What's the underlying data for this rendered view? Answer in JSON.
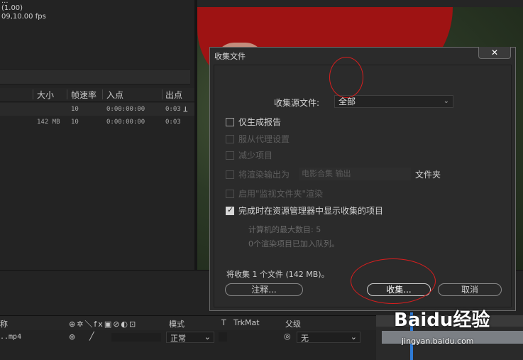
{
  "project_panel": {
    "info_line1": "...",
    "info_line2": "(1.00)",
    "info_line3": "09,10.00 fps",
    "columns": [
      "大小",
      "帧速率",
      "入点",
      "出点"
    ],
    "rows": [
      {
        "size": "",
        "fps": "10",
        "in": "0:00:00:00",
        "out": "0:03"
      },
      {
        "size": "142 MB",
        "fps": "10",
        "in": "0:00:00:00",
        "out": "0:03"
      }
    ]
  },
  "timeline": {
    "columns": {
      "name_suffix": "称",
      "mode": "模式",
      "t": "T",
      "trkmat": "TrkMat",
      "parent": "父级"
    },
    "layer": {
      "name": "..mp4",
      "mode": "正常",
      "parent": "无"
    }
  },
  "dialog": {
    "title": "收集文件",
    "close": "✕",
    "source_label": "收集源文件:",
    "source_value": "全部",
    "options": [
      {
        "label": "仅生成报告",
        "checked": false,
        "enabled": true
      },
      {
        "label": "服从代理设置",
        "checked": false,
        "enabled": false
      },
      {
        "label": "减少项目",
        "checked": false,
        "enabled": false
      },
      {
        "label": "将渲染输出为",
        "checked": false,
        "enabled": false
      },
      {
        "label": "启用\"监视文件夹\"渲染",
        "checked": false,
        "enabled": false
      },
      {
        "label": "完成时在资源管理器中显示收集的项目",
        "checked": true,
        "enabled": true
      }
    ],
    "render_folder_value": "电影合集 输出",
    "render_folder_suffix": "文件夹",
    "max_machines": "计算机的最大数目: 5",
    "queued_items": "0个渲染项目已加入队列。",
    "summary": "将收集 1 个文件 (142 MB)。",
    "buttons": {
      "notes": "注释...",
      "collect": "收集...",
      "cancel": "取消"
    }
  },
  "watermark": {
    "brand": "Baidu经验",
    "url": "jingyan.baidu.com"
  },
  "colors": {
    "annotation": "#d81e1e",
    "hat_red": "#9e1313"
  }
}
